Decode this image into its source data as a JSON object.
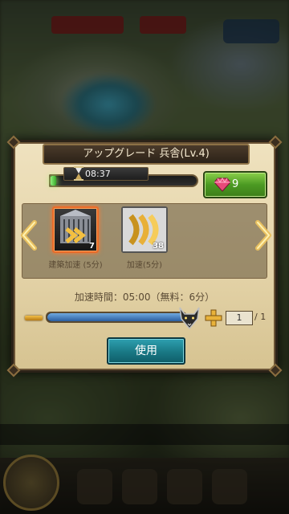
{
  "dialog": {
    "title": "アップグレード 兵舎(Lv.4)",
    "timer": "08:37",
    "timer_progress": 0.04,
    "gem_cost": "9"
  },
  "items": [
    {
      "label": "建築加速 (5分)",
      "count": "7",
      "selected": true,
      "icon": "building-speedup-icon"
    },
    {
      "label": "加速(5分)",
      "count": "38",
      "selected": false,
      "icon": "speedup-icon"
    }
  ],
  "speed_text": "加速時間：05:00（無料：6分）",
  "slider": {
    "value": 1,
    "max": 1,
    "fraction": 1.0
  },
  "quantity": {
    "current": "1",
    "max_label": "/ 1"
  },
  "use_button_label": "使用",
  "colors": {
    "accent_green": "#4c9a23",
    "use_button": "#197884",
    "selected_border": "#e86c2a"
  }
}
